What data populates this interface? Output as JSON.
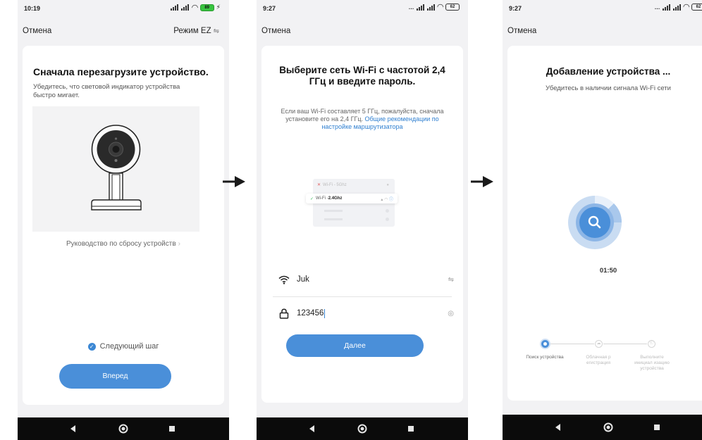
{
  "screen1": {
    "status": {
      "time": "10:19",
      "battery": "89"
    },
    "topbar": {
      "cancel": "Отмена",
      "mode": "Режим EZ"
    },
    "title": "Сначала перезагрузите устройство.",
    "subtitle": "Убедитесь, что световой индикатор устройства быстро мигает.",
    "reset_guide": "Руководство по сбросу устройств",
    "next_step": "Следующий шаг",
    "next_step_checked": true,
    "forward_button": "Вперед"
  },
  "screen2": {
    "status": {
      "time": "9:27",
      "battery": "62"
    },
    "topbar": {
      "cancel": "Отмена"
    },
    "title": "Выберите сеть Wi-Fi с частотой 2,4 ГГц и введите пароль.",
    "desc_text": "Если ваш Wi-Fi составляет 5 ГГц, пожалуйста, сначала установите его на 2,4 ГГц.",
    "desc_link": "Общие рекомендации по настройке маршрутизатора",
    "illus": {
      "row_5g": "Wi-Fi - 5Ghz",
      "row_24_prefix": "Wi-Fi - ",
      "row_24_bold": "2.4Ghz"
    },
    "ssid": "Juk",
    "password": "123456",
    "next_button": "Далее"
  },
  "screen3": {
    "status": {
      "time": "9:27",
      "battery": "62"
    },
    "topbar": {
      "cancel": "Отмена"
    },
    "title": "Добавление устройства ...",
    "subtitle": "Убедитесь в наличии сигнала Wi-Fi сети",
    "timer": "01:50",
    "steps": [
      {
        "label": "Поиск устройства",
        "active": true
      },
      {
        "label": "Облачная р егистрация",
        "active": false
      },
      {
        "label": "Выполните инициал изацию устройства",
        "active": false
      }
    ]
  },
  "colors": {
    "accent": "#4a8fd9",
    "link": "#2f7fd0",
    "nav": "#0b0b0b"
  }
}
